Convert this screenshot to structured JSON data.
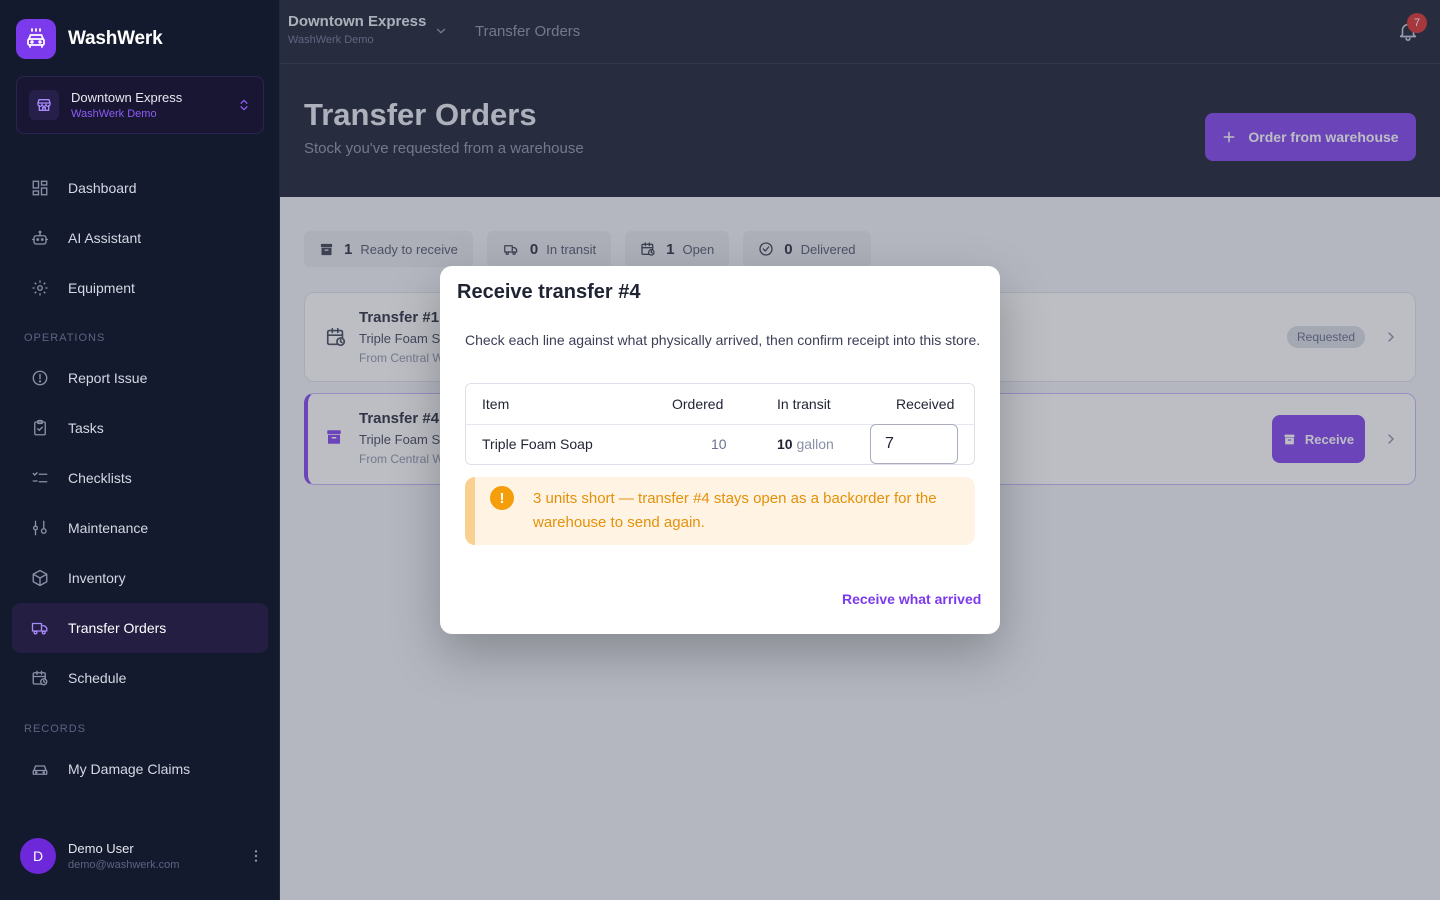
{
  "app": {
    "name": "WashWerk"
  },
  "store": {
    "name": "Downtown Express",
    "org": "WashWerk Demo"
  },
  "nav": {
    "items": [
      {
        "label": "Dashboard",
        "icon": "grid-icon"
      },
      {
        "label": "AI Assistant",
        "icon": "robot-icon"
      },
      {
        "label": "Equipment",
        "icon": "gear-icon"
      }
    ],
    "section_operations": "OPERATIONS",
    "ops_items": [
      {
        "label": "Report Issue",
        "icon": "alert-circle-icon"
      },
      {
        "label": "Tasks",
        "icon": "clipboard-check-icon"
      },
      {
        "label": "Checklists",
        "icon": "list-check-icon"
      },
      {
        "label": "Maintenance",
        "icon": "wrench-icon"
      },
      {
        "label": "Inventory",
        "icon": "box-icon"
      },
      {
        "label": "Transfer Orders",
        "icon": "truck-icon",
        "active": true
      },
      {
        "label": "Schedule",
        "icon": "calendar-clock-icon"
      }
    ],
    "section_records": "RECORDS",
    "records_items": [
      {
        "label": "My Damage Claims",
        "icon": "car-icon"
      }
    ]
  },
  "user": {
    "initial": "D",
    "name": "Demo User",
    "email": "demo@washwerk.com"
  },
  "topbar": {
    "store_name": "Downtown Express",
    "store_org": "WashWerk Demo",
    "breadcrumb": "Transfer Orders",
    "notifications": "7"
  },
  "header": {
    "title": "Transfer Orders",
    "subtitle": "Stock you've requested from a warehouse",
    "order_button": "Order from warehouse"
  },
  "stats": [
    {
      "count": "1",
      "label": "Ready to receive"
    },
    {
      "count": "0",
      "label": "In transit"
    },
    {
      "count": "1",
      "label": "Open"
    },
    {
      "count": "0",
      "label": "Delivered"
    }
  ],
  "transfers": [
    {
      "title": "Transfer #1",
      "line": "Triple Foam So",
      "from": "From Central W",
      "status": "Requested"
    },
    {
      "title": "Transfer #4",
      "line": "Triple Foam So",
      "from": "From Central W",
      "action": "Receive"
    }
  ],
  "modal": {
    "title": "Receive transfer #4",
    "description": "Check each line against what physically arrived, then confirm receipt into this store.",
    "columns": {
      "item": "Item",
      "ordered": "Ordered",
      "in_transit": "In transit",
      "received": "Received"
    },
    "row": {
      "item": "Triple Foam Soap",
      "ordered": "10",
      "in_transit": "10",
      "unit": "gallon",
      "received": "7"
    },
    "warning": "3 units short — transfer #4 stays open as a backorder for the warehouse to send again.",
    "action": "Receive what arrived"
  },
  "colors": {
    "accent": "#7c3aed",
    "sidebar": "#141a2e",
    "warning": "#f59e0b",
    "danger": "#dc2626"
  }
}
